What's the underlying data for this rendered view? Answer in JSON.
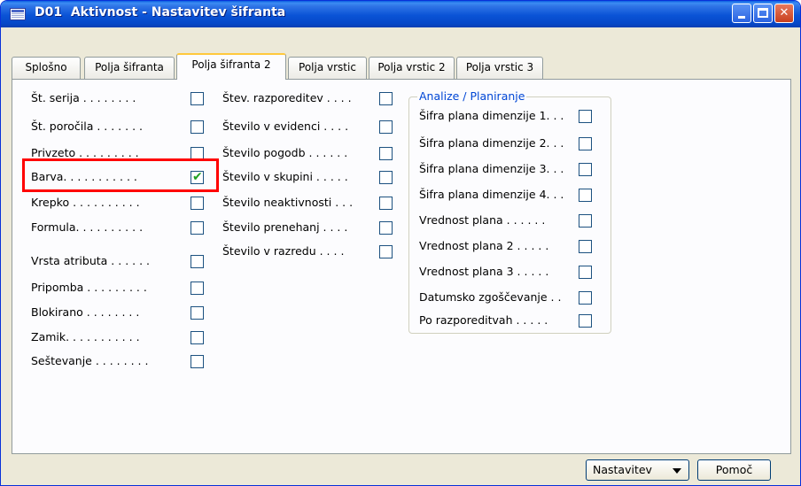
{
  "window": {
    "title": "D01  Aktivnost - Nastavitev šifranta",
    "icon": "form-icon"
  },
  "tabs": [
    {
      "label": "Splošno"
    },
    {
      "label": "Polja šifranta"
    },
    {
      "label": "Polja šifranta 2",
      "active": true
    },
    {
      "label": "Polja vrstic"
    },
    {
      "label": "Polja vrstic 2"
    },
    {
      "label": "Polja vrstic 3"
    }
  ],
  "column1": [
    {
      "label": "Št. serija . . . . . . . .",
      "checked": false
    },
    {
      "label": "Št. poročila . . . . . . .",
      "checked": false
    },
    {
      "label": "Privzeto . . . . . . . . .",
      "checked": false
    },
    {
      "label": "Barva. . . . . . . . . . .",
      "checked": true
    },
    {
      "label": "Krepko . . . . . . . . . .",
      "checked": false
    },
    {
      "label": "Formula. . . . . . . . . .",
      "checked": false
    },
    {
      "label": "Vrsta atributa . . . . . .",
      "checked": false
    },
    {
      "label": "Pripomba . . . . . . . . .",
      "checked": false
    },
    {
      "label": "Blokirano . . . . . . . .",
      "checked": false
    },
    {
      "label": "Zamik. . . . . . . . . . .",
      "checked": false
    },
    {
      "label": "Seštevanje . . . . . . . .",
      "checked": false
    }
  ],
  "column2": [
    {
      "label": "Štev. razporeditev  . . . .",
      "checked": false
    },
    {
      "label": "Število v evidenci . . . .",
      "checked": false
    },
    {
      "label": "Število pogodb . . . . . .",
      "checked": false
    },
    {
      "label": "Število v skupini . . . . .",
      "checked": false
    },
    {
      "label": "Število neaktivnosti . . .",
      "checked": false
    },
    {
      "label": "Število prenehanj . . . .",
      "checked": false
    },
    {
      "label": "Število v razredu . . . .",
      "checked": false
    }
  ],
  "analize": {
    "title": "Analize / Planiranje",
    "items": [
      {
        "label": "Šifra plana dimenzije 1. . .",
        "checked": false
      },
      {
        "label": "Šifra plana dimenzije 2. . .",
        "checked": false
      },
      {
        "label": "Šifra plana dimenzije 3. . .",
        "checked": false
      },
      {
        "label": "Šifra plana dimenzije 4. . .",
        "checked": false
      },
      {
        "label": "Vrednost plana . . . . . .",
        "checked": false
      },
      {
        "label": "Vrednost plana 2 . . . . .",
        "checked": false
      },
      {
        "label": "Vrednost plana 3 . . . . .",
        "checked": false
      },
      {
        "label": "Datumsko zgoščevanje  . .",
        "checked": false
      },
      {
        "label": "Po razporeditvah . . . . .",
        "checked": false
      }
    ]
  },
  "buttons": {
    "nastavitev": "Nastavitev",
    "pomoc": "Pomoč"
  },
  "colors": {
    "titlebar": "#0a53d6",
    "highlight": "#ff0000",
    "group_title": "#0046d5",
    "check": "#21a121"
  }
}
